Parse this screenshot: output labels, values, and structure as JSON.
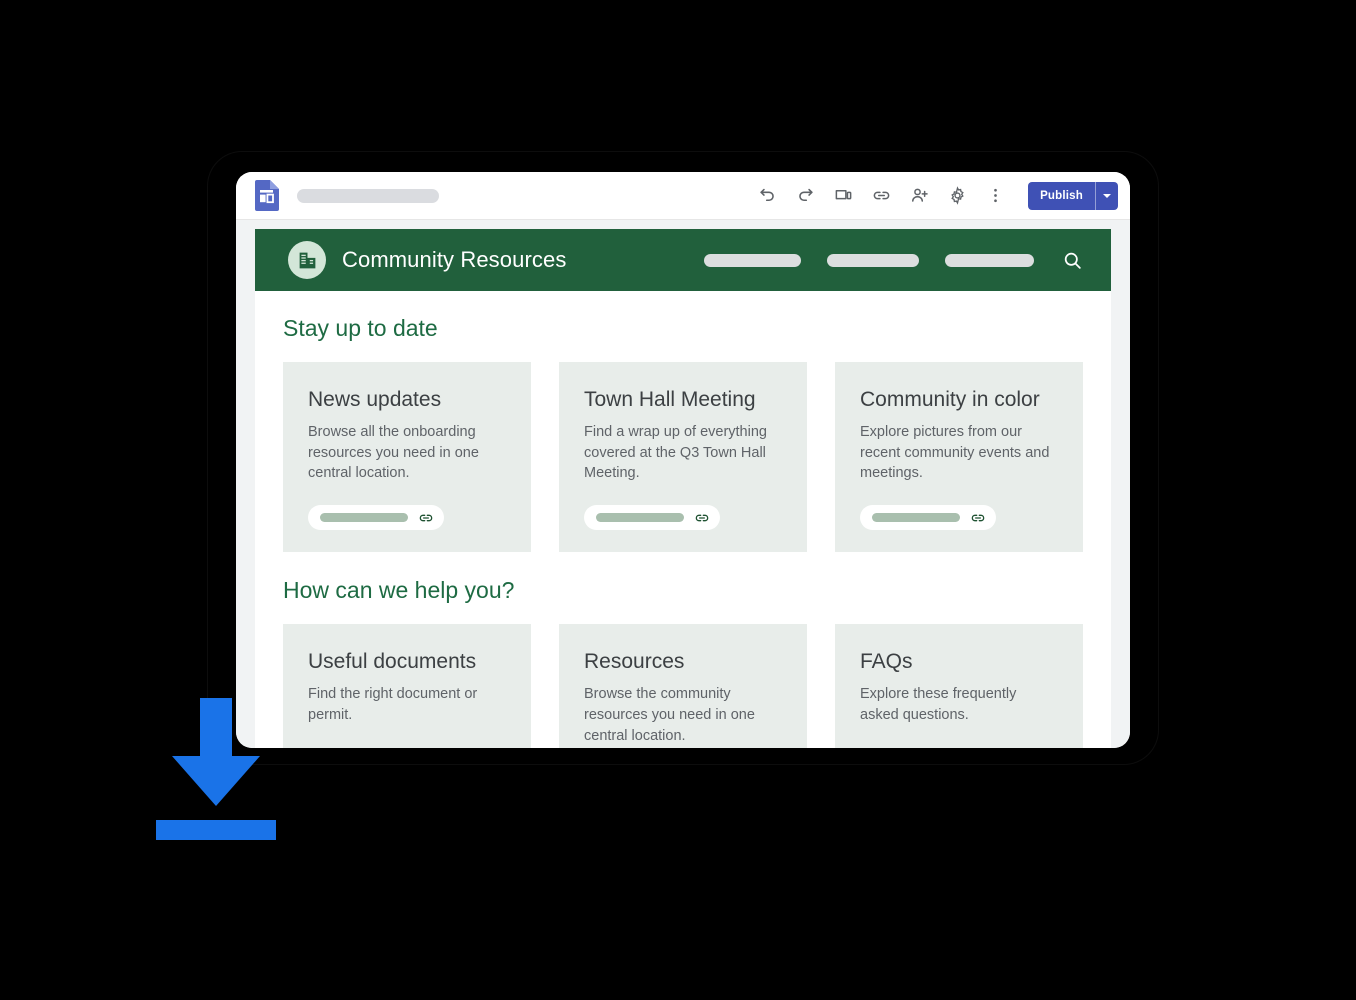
{
  "editor": {
    "app_icon": "google-sites-icon",
    "title_placeholder": "",
    "toolbar_icons": [
      {
        "name": "undo-icon",
        "label": "Undo"
      },
      {
        "name": "redo-icon",
        "label": "Redo"
      },
      {
        "name": "preview-icon",
        "label": "Preview"
      },
      {
        "name": "link-icon",
        "label": "Copy site link"
      },
      {
        "name": "add-person-icon",
        "label": "Share with others"
      },
      {
        "name": "settings-gear-icon",
        "label": "Settings"
      },
      {
        "name": "more-options-icon",
        "label": "More"
      }
    ],
    "publish_label": "Publish",
    "publish_caret": "chevron-down-icon",
    "publish_color": "#3f51b5"
  },
  "site": {
    "banner": {
      "logo_icon": "apartment-building-icon",
      "title": "Community Resources",
      "background_color": "#21603c",
      "logo_background_color": "#d3e6d8",
      "nav_placeholders": [
        "",
        "",
        ""
      ],
      "search_icon": "search-icon"
    },
    "sections": [
      {
        "heading": "Stay up to date",
        "cards": [
          {
            "title": "News updates",
            "description": "Browse all the onboarding resources you need in one central location.",
            "link_icon": "link-chain-icon",
            "link_label": ""
          },
          {
            "title": "Town Hall Meeting",
            "description": "Find a wrap up of everything covered at the Q3 Town Hall Meeting.",
            "link_icon": "link-chain-icon",
            "link_label": ""
          },
          {
            "title": "Community in color",
            "description": "Explore pictures from our recent community events and meetings.",
            "link_icon": "link-chain-icon",
            "link_label": ""
          }
        ]
      },
      {
        "heading": "How can we help you?",
        "cards": [
          {
            "title": "Useful documents",
            "description": "Find the right document or permit.",
            "link_icon": "",
            "link_label": ""
          },
          {
            "title": "Resources",
            "description": "Browse the community resources you need in one central location.",
            "link_icon": "",
            "link_label": ""
          },
          {
            "title": "FAQs",
            "description": "Explore these frequently asked questions.",
            "link_icon": "",
            "link_label": ""
          }
        ]
      }
    ],
    "heading_color": "#1e6b43",
    "card_background_color": "#e8edea"
  },
  "overlay": {
    "download_icon": "download-arrow-icon",
    "download_color": "#1a73e8"
  }
}
